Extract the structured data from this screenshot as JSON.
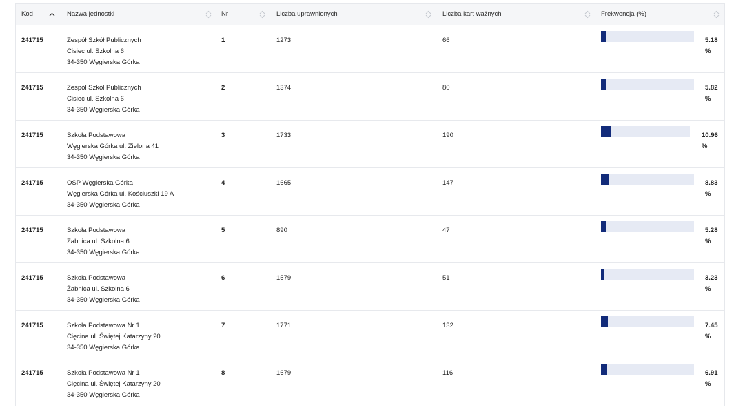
{
  "headers": {
    "kod": "Kod",
    "nazwa": "Nazwa jednostki",
    "nr": "Nr",
    "uprawnionych": "Liczba uprawnionych",
    "karty": "Liczba kart ważnych",
    "frekwencja": "Frekwencja (%)"
  },
  "rows": [
    {
      "kod": "241715",
      "name1": "Zespół Szkół Publicznych",
      "name2": "Cisiec ul. Szkolna 6",
      "name3": "34-350 Węgierska Górka",
      "nr": "1",
      "uprawnionych": "1273",
      "karty": "66",
      "frekwencja": "5.18",
      "unit": "%",
      "level": 5.18
    },
    {
      "kod": "241715",
      "name1": "Zespół Szkół Publicznych",
      "name2": "Cisiec ul. Szkolna 6",
      "name3": "34-350 Węgierska Górka",
      "nr": "2",
      "uprawnionych": "1374",
      "karty": "80",
      "frekwencja": "5.82",
      "unit": "%",
      "level": 5.82
    },
    {
      "kod": "241715",
      "name1": "Szkoła Podstawowa",
      "name2": "Węgierska Górka ul. Zielona 41",
      "name3": "34-350 Węgierska Górka",
      "nr": "3",
      "uprawnionych": "1733",
      "karty": "190",
      "frekwencja": "10.96",
      "unit": "%",
      "level": 10.96
    },
    {
      "kod": "241715",
      "name1": "OSP Węgierska Górka",
      "name2": "Węgierska Górka ul. Kościuszki 19 A",
      "name3": "34-350 Węgierska Górka",
      "nr": "4",
      "uprawnionych": "1665",
      "karty": "147",
      "frekwencja": "8.83",
      "unit": "%",
      "level": 8.83
    },
    {
      "kod": "241715",
      "name1": "Szkoła Podstawowa",
      "name2": "Żabnica ul. Szkolna 6",
      "name3": "34-350 Węgierska Górka",
      "nr": "5",
      "uprawnionych": "890",
      "karty": "47",
      "frekwencja": "5.28",
      "unit": "%",
      "level": 5.28
    },
    {
      "kod": "241715",
      "name1": "Szkoła Podstawowa",
      "name2": "Żabnica ul. Szkolna 6",
      "name3": "34-350 Węgierska Górka",
      "nr": "6",
      "uprawnionych": "1579",
      "karty": "51",
      "frekwencja": "3.23",
      "unit": "%",
      "level": 3.23
    },
    {
      "kod": "241715",
      "name1": "Szkoła Podstawowa Nr 1",
      "name2": "Cięcina ul. Świętej Katarzyny 20",
      "name3": "34-350 Węgierska Górka",
      "nr": "7",
      "uprawnionych": "1771",
      "karty": "132",
      "frekwencja": "7.45",
      "unit": "%",
      "level": 7.45
    },
    {
      "kod": "241715",
      "name1": "Szkoła Podstawowa Nr 1",
      "name2": "Cięcina ul. Świętej Katarzyny 20",
      "name3": "34-350 Węgierska Górka",
      "nr": "8",
      "uprawnionych": "1679",
      "karty": "116",
      "frekwencja": "6.91",
      "unit": "%",
      "level": 6.91
    }
  ],
  "colors": {
    "bar_fill": "#122b7a",
    "bar_track": "#e6eaf4",
    "header_bg": "#f5f6f8"
  }
}
